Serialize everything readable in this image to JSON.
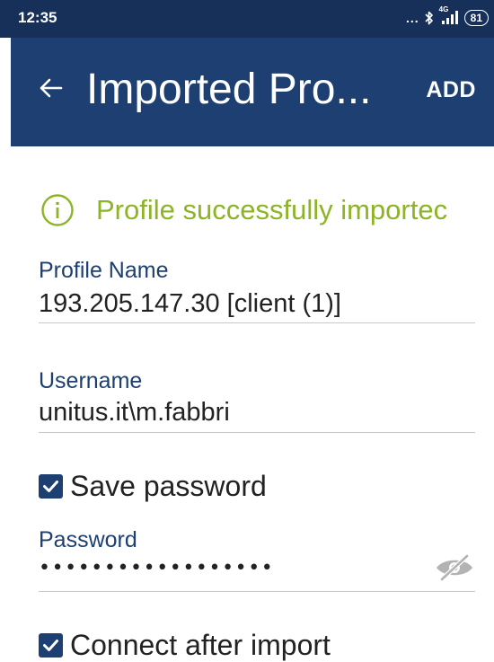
{
  "status_bar": {
    "time": "12:35",
    "dots": "...",
    "network": "4G",
    "battery": "81",
    "icons": [
      "more-dots-icon",
      "bluetooth-icon",
      "signal-icon",
      "battery-icon"
    ]
  },
  "app_bar": {
    "title": "Imported Pro...",
    "add_label": "ADD",
    "back_icon": "back-arrow-icon"
  },
  "notice": {
    "text": "Profile successfully importec",
    "icon": "info-icon",
    "color": "#8cb425"
  },
  "profile": {
    "label": "Profile Name",
    "value": "193.205.147.30 [client (1)]"
  },
  "username": {
    "label": "Username",
    "value": "unitus.it\\m.fabbri"
  },
  "save_password": {
    "label": "Save password",
    "checked": true
  },
  "password": {
    "label": "Password",
    "value": "••••••••••••••••••",
    "visibility_icon": "eye-off-icon"
  },
  "connect_after_import": {
    "label": "Connect after import",
    "checked": true
  },
  "colors": {
    "primary": "#1d3f72",
    "status_bar": "#16305a",
    "success": "#8cb425"
  }
}
